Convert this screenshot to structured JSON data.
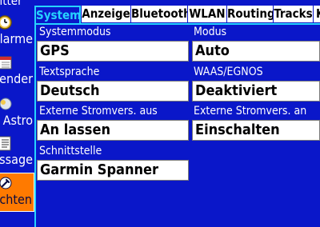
{
  "sidebar": {
    "header": "Gitter",
    "items": [
      {
        "label": "Alarme",
        "icon": "alarm-clock-icon",
        "active": false
      },
      {
        "label": "Kalender",
        "icon": "calendar-icon",
        "active": false
      },
      {
        "label": "Astro",
        "icon": "sun-moon-icon",
        "active": false
      },
      {
        "label": "Message",
        "icon": "document-icon",
        "active": false
      },
      {
        "label": "Schlichten",
        "icon": "wrench-icon",
        "active": true
      }
    ]
  },
  "tabs": [
    {
      "label": "System",
      "active": true
    },
    {
      "label": "Anzeige",
      "active": false
    },
    {
      "label": "Bluetooth",
      "active": false
    },
    {
      "label": "WLAN",
      "active": false
    },
    {
      "label": "Routing",
      "active": false
    },
    {
      "label": "Tracks",
      "active": false
    },
    {
      "label": "K",
      "active": false
    }
  ],
  "fields": {
    "systemmodus": {
      "label": "Systemmodus",
      "value": "GPS"
    },
    "modus": {
      "label": "Modus",
      "value": "Auto"
    },
    "textsprache": {
      "label": "Textsprache",
      "value": "Deutsch"
    },
    "waas": {
      "label": "WAAS/EGNOS",
      "value": "Deaktiviert"
    },
    "strom_aus": {
      "label": "Externe Stromvers. aus",
      "value": "An lassen"
    },
    "strom_an": {
      "label": "Externe Stromvers. an",
      "value": "Einschalten"
    },
    "schnittstelle": {
      "label": "Schnittstelle",
      "value": "Garmin Spanner"
    }
  },
  "colors": {
    "background": "#0a17c9",
    "active_tab_text": "#26d3ff",
    "active_sidebar": "#ff7a00"
  }
}
